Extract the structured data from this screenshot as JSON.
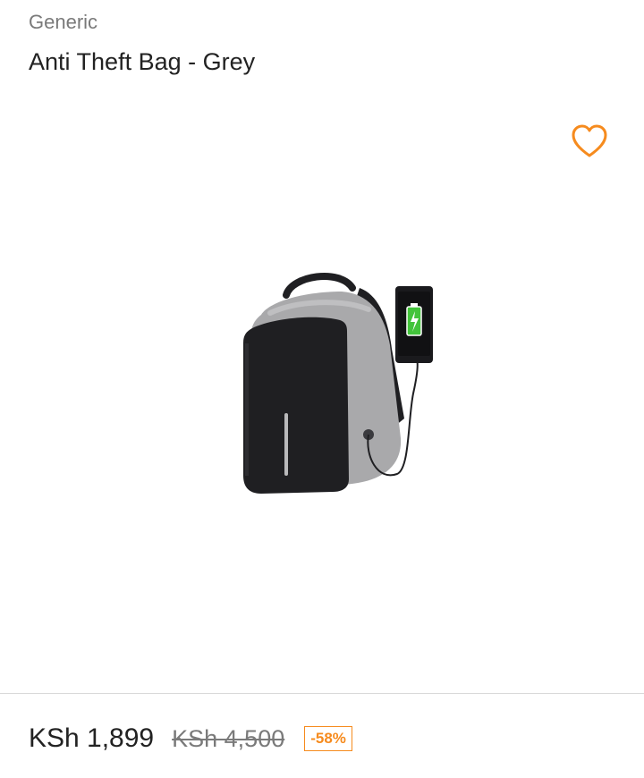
{
  "product": {
    "brand": "Generic",
    "title": "Anti Theft Bag - Grey",
    "image_icon": "backpack-product-image",
    "wishlist_icon": "heart-outline-icon"
  },
  "pricing": {
    "price": "KSh 1,899",
    "old_price": "KSh 4,500",
    "discount": "-58%"
  },
  "colors": {
    "accent": "#f68b1e",
    "bag_grey": "#a9a9ab",
    "bag_black": "#1f1f22",
    "battery_green": "#43c43b"
  }
}
